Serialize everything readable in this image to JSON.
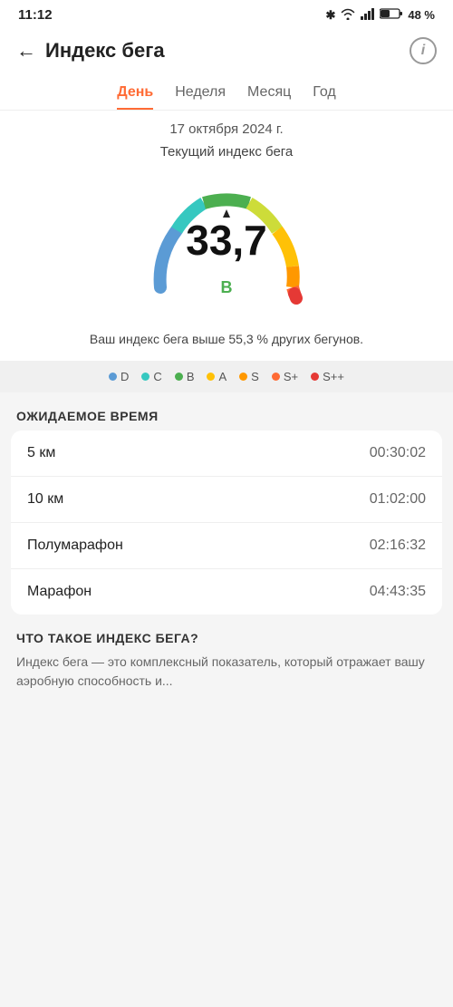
{
  "statusBar": {
    "time": "11:12",
    "battery": "48 %",
    "icons": {
      "bluetooth": "✱",
      "wifi": "🛜",
      "signal": "📶"
    }
  },
  "header": {
    "back": "←",
    "title": "Индекс бега",
    "info": "i"
  },
  "tabs": [
    {
      "label": "День",
      "active": true
    },
    {
      "label": "Неделя",
      "active": false
    },
    {
      "label": "Месяц",
      "active": false
    },
    {
      "label": "Год",
      "active": false
    }
  ],
  "date": "17 октября 2024 г.",
  "subtitle": "Текущий индекс бега",
  "gauge": {
    "value": "33,7",
    "grade": "B",
    "markerSymbol": "▲"
  },
  "infoText": "Ваш индекс бега выше 55,3 % других бегунов.",
  "legend": [
    {
      "label": "D",
      "color": "#5B9BD5"
    },
    {
      "label": "C",
      "color": "#36A2D9"
    },
    {
      "label": "B",
      "color": "#4CAF50"
    },
    {
      "label": "A",
      "color": "#FFC107"
    },
    {
      "label": "S",
      "color": "#FF9800"
    },
    {
      "label": "S+",
      "color": "#FF6B35"
    },
    {
      "label": "S++",
      "color": "#E53935"
    }
  ],
  "expectedTime": {
    "sectionTitle": "ОЖИДАЕМОЕ ВРЕМЯ",
    "rows": [
      {
        "label": "5 км",
        "value": "00:30:02"
      },
      {
        "label": "10 км",
        "value": "01:02:00"
      },
      {
        "label": "Полумарафон",
        "value": "02:16:32"
      },
      {
        "label": "Марафон",
        "value": "04:43:35"
      }
    ]
  },
  "whatIs": {
    "sectionTitle": "ЧТО ТАКОЕ ИНДЕКС БЕГА?",
    "text": "Индекс бега — это комплексный показатель, который отражает вашу аэробную способность и..."
  }
}
